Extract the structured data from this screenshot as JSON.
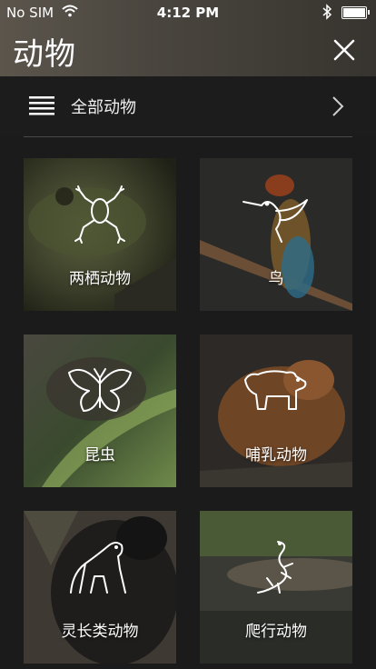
{
  "status_bar": {
    "carrier": "No SIM",
    "time": "4:12 PM"
  },
  "header": {
    "title": "动物",
    "close_icon": "close-icon"
  },
  "filter": {
    "label": "全部动物",
    "menu_icon": "list-icon",
    "chevron_icon": "chevron-right-icon"
  },
  "categories": [
    {
      "label": "两栖动物",
      "icon": "frog-icon"
    },
    {
      "label": "鸟",
      "icon": "hummingbird-icon"
    },
    {
      "label": "昆虫",
      "icon": "butterfly-icon"
    },
    {
      "label": "哺乳动物",
      "icon": "bear-icon"
    },
    {
      "label": "灵长类动物",
      "icon": "gorilla-icon"
    },
    {
      "label": "爬行动物",
      "icon": "lizard-icon"
    }
  ],
  "colors": {
    "background": "#1b1b1b",
    "header": "#4a463f"
  }
}
